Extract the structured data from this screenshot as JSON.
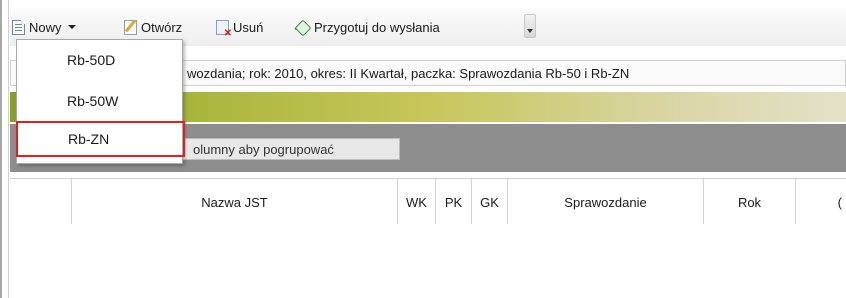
{
  "toolbar": {
    "new_label": "Nowy",
    "open_label": "Otwórz",
    "delete_label": "Usuń",
    "prepare_label": "Przygotuj do wysłania"
  },
  "info_bar": {
    "text": "wozdania; rok: 2010, okres: II Kwartał, paczka: Sprawozdania Rb-50 i Rb-ZN"
  },
  "group_area": {
    "hint": "olumny aby pogrupować"
  },
  "grid": {
    "columns": [
      "Nazwa JST",
      "WK",
      "PK",
      "GK",
      "Sprawozdanie",
      "Rok",
      "("
    ]
  },
  "new_menu": {
    "items": [
      "Rb-50D",
      "Rb-50W",
      "Rb-ZN"
    ],
    "selected": "Rb-ZN"
  },
  "colors": {
    "accent_green": "#8a9d24",
    "selection_border": "#e02020"
  }
}
